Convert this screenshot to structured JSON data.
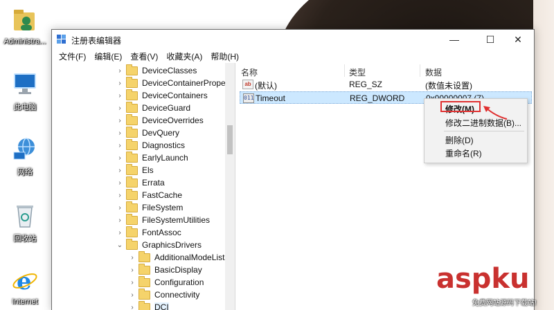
{
  "desktop": {
    "icons": [
      {
        "label": "Administra...",
        "icon": "user-folder-icon"
      },
      {
        "label": "此电脑",
        "icon": "computer-icon"
      },
      {
        "label": "网络",
        "icon": "network-icon"
      },
      {
        "label": "回收站",
        "icon": "recycle-bin-icon"
      },
      {
        "label": "Internet",
        "icon": "internet-explorer-icon"
      }
    ]
  },
  "window": {
    "title": "注册表编辑器",
    "controls": {
      "minimize": "—",
      "maximize": "☐",
      "close": "✕"
    },
    "menu": [
      "文件(F)",
      "编辑(E)",
      "查看(V)",
      "收藏夹(A)",
      "帮助(H)"
    ]
  },
  "tree": {
    "items": [
      {
        "label": "DeviceClasses",
        "level": 1
      },
      {
        "label": "DeviceContainerPropert",
        "level": 1
      },
      {
        "label": "DeviceContainers",
        "level": 1
      },
      {
        "label": "DeviceGuard",
        "level": 1
      },
      {
        "label": "DeviceOverrides",
        "level": 1
      },
      {
        "label": "DevQuery",
        "level": 1
      },
      {
        "label": "Diagnostics",
        "level": 1
      },
      {
        "label": "EarlyLaunch",
        "level": 1
      },
      {
        "label": "Els",
        "level": 1
      },
      {
        "label": "Errata",
        "level": 1
      },
      {
        "label": "FastCache",
        "level": 1
      },
      {
        "label": "FileSystem",
        "level": 1
      },
      {
        "label": "FileSystemUtilities",
        "level": 1
      },
      {
        "label": "FontAssoc",
        "level": 1
      },
      {
        "label": "GraphicsDrivers",
        "level": 1,
        "expanded": true
      },
      {
        "label": "AdditionalModeLists",
        "level": 2
      },
      {
        "label": "BasicDisplay",
        "level": 2
      },
      {
        "label": "Configuration",
        "level": 2
      },
      {
        "label": "Connectivity",
        "level": 2
      },
      {
        "label": "DCI",
        "level": 2,
        "selected": true
      }
    ]
  },
  "values": {
    "columns": [
      "名称",
      "类型",
      "数据"
    ],
    "rows": [
      {
        "name": "(默认)",
        "type": "REG_SZ",
        "data": "(数值未设置)",
        "icon": "string-value-icon"
      },
      {
        "name": "Timeout",
        "type": "REG_DWORD",
        "data": "0x00000007 (7)",
        "icon": "binary-value-icon",
        "selected": true
      }
    ]
  },
  "context_menu": {
    "items": [
      "修改(M)...",
      "修改二进制数据(B)...",
      "删除(D)",
      "重命名(R)"
    ]
  },
  "watermark": {
    "main": "aspku",
    "sub": "免费网站源码下载站!"
  },
  "colors": {
    "accent_selection": "#cce8ff",
    "annotation_red": "#e03030",
    "watermark_red": "#c9312f"
  }
}
